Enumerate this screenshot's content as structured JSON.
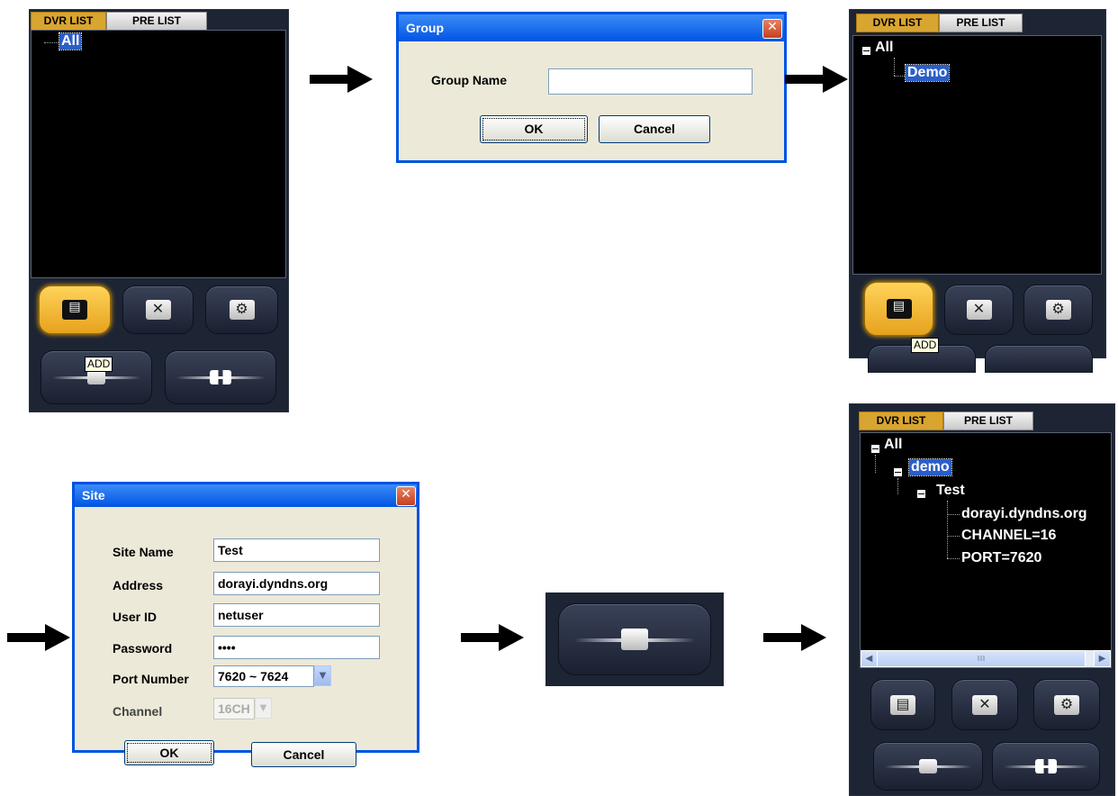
{
  "tabs": {
    "dvr": "DVR LIST",
    "pre": "PRE LIST"
  },
  "tooltip": "ADD",
  "icons": {
    "add": "add-group-icon",
    "delete": "delete-icon",
    "settings": "settings-icon",
    "connect": "connect-plug-icon",
    "disconnect": "disconnect-plug-icon"
  },
  "panel1": {
    "tree_root": "All"
  },
  "group_dialog": {
    "title": "Group",
    "label": "Group Name",
    "value": "",
    "ok": "OK",
    "cancel": "Cancel",
    "close": "✕"
  },
  "panel2": {
    "tree_root": "All",
    "child": "Demo"
  },
  "site_dialog": {
    "title": "Site",
    "close": "✕",
    "fields": {
      "site_name": {
        "label": "Site Name",
        "value": "Test"
      },
      "address": {
        "label": "Address",
        "value": "dorayi.dyndns.org"
      },
      "user_id": {
        "label": "User ID",
        "value": "netuser"
      },
      "password": {
        "label": "Password",
        "value": "••••"
      },
      "port": {
        "label": "Port Number",
        "value": "7620 ~ 7624"
      },
      "channel": {
        "label": "Channel",
        "value": "16CH"
      }
    },
    "ok": "OK",
    "cancel": "Cancel"
  },
  "panel3": {
    "tree_root": "All",
    "group": "demo",
    "site": "Test",
    "details": [
      "dorayi.dyndns.org",
      "CHANNEL=16",
      "PORT=7620"
    ],
    "scroll_glyph": "III"
  },
  "colors": {
    "accent_gold": "#e6a21d",
    "selection": "#2b5ec8",
    "title_blue": "#0054e3"
  }
}
